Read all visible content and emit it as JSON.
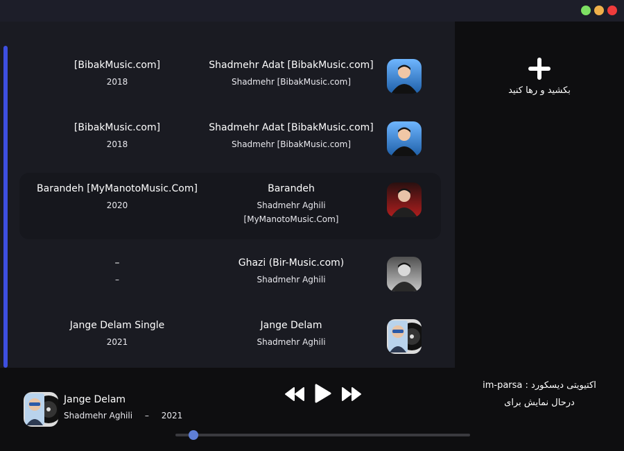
{
  "window": {
    "buttons": [
      {
        "name": "maximize",
        "color": "#7ee063"
      },
      {
        "name": "minimize",
        "color": "#f0b04a"
      },
      {
        "name": "close",
        "color": "#f03c3c"
      }
    ]
  },
  "colors": {
    "accent": "#3d4fe0",
    "panel": "#1a1b22",
    "background": "#0e0e10",
    "progress_thumb": "#5f7fd6"
  },
  "tracks": [
    {
      "album": "[BibakMusic.com]",
      "year": "2018",
      "title": "Shadmehr Adat [BibakMusic.com]",
      "artist": "Shadmehr [BibakMusic.com]",
      "cover": "artist-photo-blue",
      "active": false
    },
    {
      "album": "[BibakMusic.com]",
      "year": "2018",
      "title": "Shadmehr Adat [BibakMusic.com]",
      "artist": "Shadmehr [BibakMusic.com]",
      "cover": "artist-photo-blue",
      "active": false
    },
    {
      "album": "Barandeh [MyManotoMusic.Com]",
      "year": "2020",
      "title": "Barandeh",
      "artist": "Shadmehr Aghili [MyManotoMusic.Com]",
      "cover": "artist-photo-red",
      "active": true
    },
    {
      "album": "–",
      "year": "–",
      "title": "Ghazi (Bir-Music.com)",
      "artist": "Shadmehr Aghili",
      "cover": "artist-photo-gray",
      "active": false
    },
    {
      "album": "Jange Delam Single",
      "year": "2021",
      "title": "Jange Delam",
      "artist": "Shadmehr Aghili",
      "cover": "vinyl-artist",
      "active": false
    }
  ],
  "dropzone": {
    "icon": "plus-icon",
    "label": "بکشید و رها کنید"
  },
  "player": {
    "title": "Jange Delam",
    "artist": "Shadmehr Aghili",
    "separator": "–",
    "year": "2021",
    "progress": 0.06,
    "icons": {
      "prev": "rewind-icon",
      "play": "play-icon",
      "next": "fast-forward-icon"
    }
  },
  "discord": {
    "line1": "اکتیویتی دیسکورد : im-parsa",
    "line2": "درحال نمایش برای"
  }
}
